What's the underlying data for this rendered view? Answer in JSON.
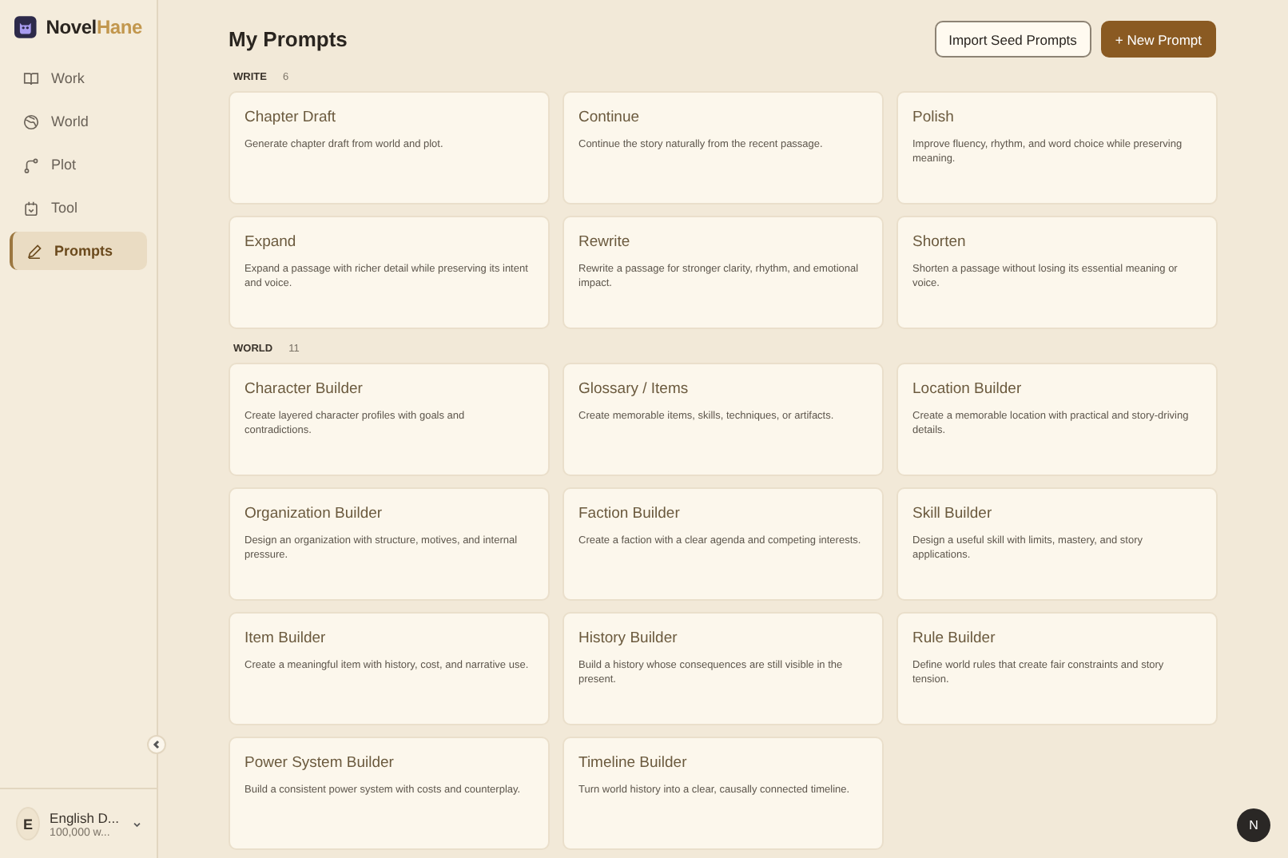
{
  "brand": {
    "name_main": "Novel",
    "name_accent": "Hane"
  },
  "sidebar": {
    "items": [
      {
        "label": "Work",
        "kind": "book",
        "selected": false
      },
      {
        "label": "World",
        "kind": "globe",
        "selected": false
      },
      {
        "label": "Plot",
        "kind": "plot",
        "selected": false
      },
      {
        "label": "Tool",
        "kind": "tool",
        "selected": false
      },
      {
        "label": "Prompts",
        "kind": "pen",
        "selected": true
      }
    ],
    "project": {
      "initial": "E",
      "name": "English D...",
      "words": "100,000 w..."
    }
  },
  "page": {
    "title": "My Prompts",
    "buttons": [
      {
        "label": "Import Seed Prompts",
        "kind": "secondary"
      },
      {
        "label": "+ New Prompt",
        "kind": "primary"
      }
    ]
  },
  "sections": [
    {
      "label": "WRITE",
      "count": "6",
      "cards": [
        {
          "title": "Chapter Draft",
          "description": "Generate chapter draft from world and plot."
        },
        {
          "title": "Continue",
          "description": "Continue the story naturally from the recent passage."
        },
        {
          "title": "Polish",
          "description": "Improve fluency, rhythm, and word choice while preserving meaning."
        },
        {
          "title": "Expand",
          "description": "Expand a passage with richer detail while preserving its intent and voice."
        },
        {
          "title": "Rewrite",
          "description": "Rewrite a passage for stronger clarity, rhythm, and emotional impact."
        },
        {
          "title": "Shorten",
          "description": "Shorten a passage without losing its essential meaning or voice."
        }
      ]
    },
    {
      "label": "WORLD",
      "count": "11",
      "cards": [
        {
          "title": "Character Builder",
          "description": "Create layered character profiles with goals and contradictions."
        },
        {
          "title": "Glossary / Items",
          "description": "Create memorable items, skills, techniques, or artifacts."
        },
        {
          "title": "Location Builder",
          "description": "Create a memorable location with practical and story-driving details."
        },
        {
          "title": "Organization Builder",
          "description": "Design an organization with structure, motives, and internal pressure."
        },
        {
          "title": "Faction Builder",
          "description": "Create a faction with a clear agenda and competing interests."
        },
        {
          "title": "Skill Builder",
          "description": "Design a useful skill with limits, mastery, and story applications."
        },
        {
          "title": "Item Builder",
          "description": "Create a meaningful item with history, cost, and narrative use."
        },
        {
          "title": "History Builder",
          "description": "Build a history whose consequences are still visible in the present."
        },
        {
          "title": "Rule Builder",
          "description": "Define world rules that create fair constraints and story tension."
        },
        {
          "title": "Power System Builder",
          "description": "Build a consistent power system with costs and counterplay."
        },
        {
          "title": "Timeline Builder",
          "description": "Turn world history into a clear, causally connected timeline."
        }
      ]
    }
  ],
  "assistant_badge": {
    "letter": "N"
  }
}
